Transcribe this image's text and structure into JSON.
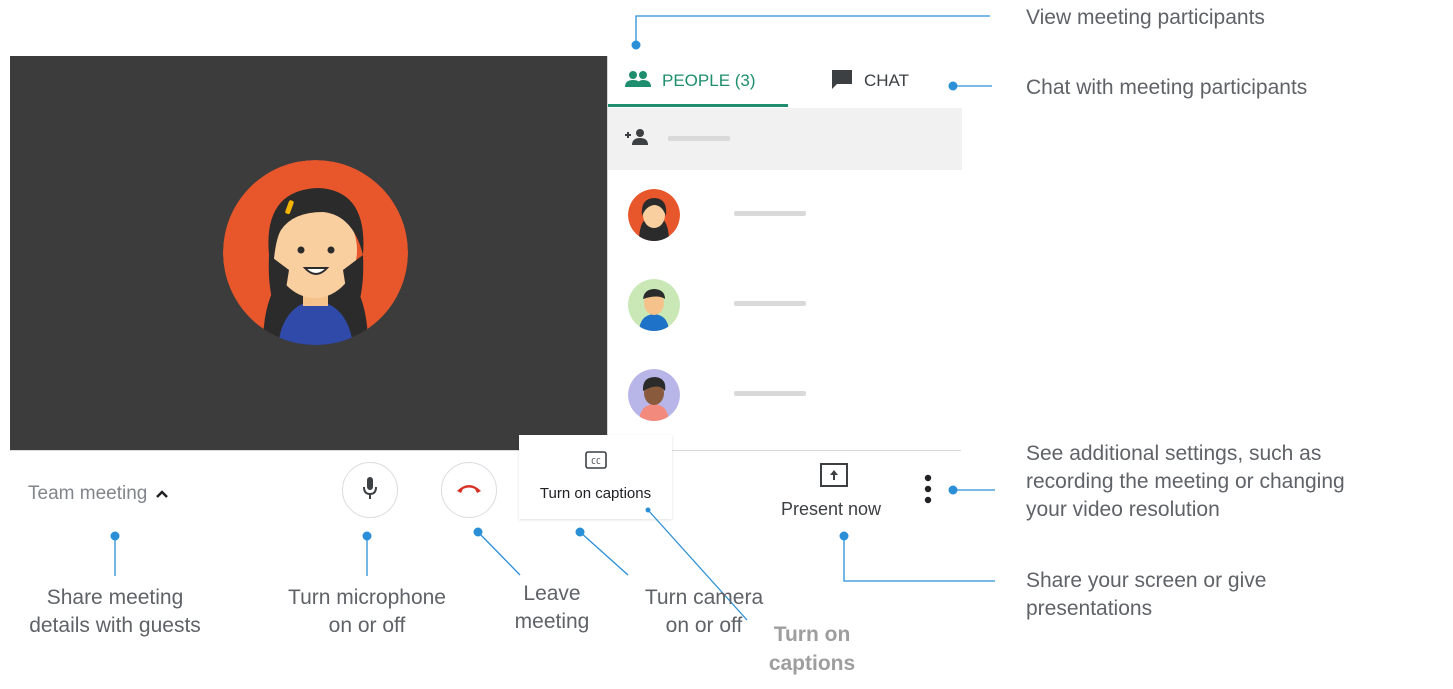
{
  "people_panel": {
    "people_tab_label": "PEOPLE (3)",
    "chat_tab_label": "CHAT",
    "people_icon": "people-icon",
    "chat_icon": "chat-bubble-icon",
    "add_person_icon": "add-person-icon"
  },
  "toolbar": {
    "meeting_name": "Team meeting",
    "meeting_chevron": "^",
    "captions_label": "Turn on captions",
    "present_label": "Present now",
    "leave_color": "#d93025"
  },
  "annotations": {
    "view_participants": "View meeting participants",
    "chat_participants": "Chat with meeting participants",
    "settings_line1": "See additional settings, such as",
    "settings_line2": "recording the meeting or changing",
    "settings_line3": "your video resolution",
    "share_line1": "Share your screen or give",
    "share_line2": "presentations",
    "meeting_details_line1": "Share meeting",
    "meeting_details_line2": "details with guests",
    "mic_line1": "Turn microphone",
    "mic_line2": "on or off",
    "leave_line1": "Leave",
    "leave_line2": "meeting",
    "camera_line1": "Turn camera",
    "camera_line2": "on or off",
    "captions_line1": "Turn on",
    "captions_line2": "captions"
  },
  "colors": {
    "accent": "#1e8e6e",
    "callout_line": "#2a8fd6",
    "stage": "#3c3c3c"
  }
}
